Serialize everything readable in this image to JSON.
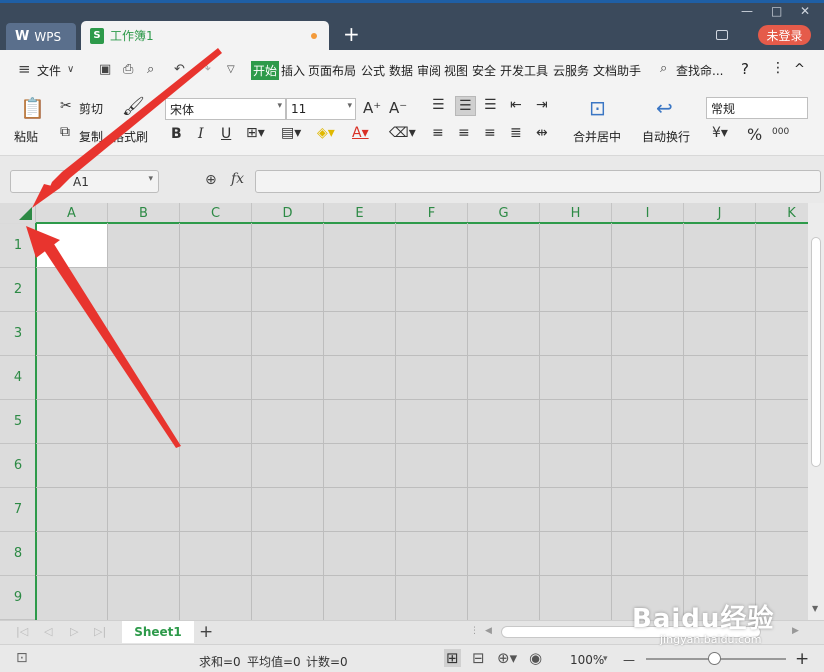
{
  "titlebar": {
    "wps_tab": "WPS",
    "doc_tab": "工作簿1",
    "new_tab": "+",
    "login": "未登录",
    "min": "—",
    "max": "□",
    "close": "✕"
  },
  "menubar": {
    "file": "文件",
    "tabs": [
      "开始",
      "插入",
      "页面布局",
      "公式",
      "数据",
      "审阅",
      "视图",
      "安全",
      "开发工具",
      "云服务",
      "文档助手"
    ],
    "search": "查找命...",
    "help": "?",
    "more": "⋮",
    "collapse": "^"
  },
  "ribbon": {
    "paste": "粘贴",
    "cut": "剪切",
    "copy": "复制",
    "format_painter": "格式刷",
    "font_name": "宋体",
    "font_size": "11",
    "bold": "B",
    "italic": "I",
    "underline": "U",
    "merge_center": "合并居中",
    "auto_wrap": "自动换行",
    "number_format": "常规",
    "percent": "%",
    "thousands": "000"
  },
  "formula_bar": {
    "name_box": "A1",
    "fx": "fx",
    "formula": ""
  },
  "grid": {
    "columns": [
      "A",
      "B",
      "C",
      "D",
      "E",
      "F",
      "G",
      "H",
      "I",
      "J",
      "K"
    ],
    "rows": [
      "1",
      "2",
      "3",
      "4",
      "5",
      "6",
      "7",
      "8",
      "9"
    ]
  },
  "sheets": {
    "active": "Sheet1",
    "add": "+"
  },
  "status": {
    "sum": "求和=0",
    "avg": "平均值=0",
    "count": "计数=0",
    "zoom": "100%",
    "zoom_out": "—",
    "zoom_in": "+"
  },
  "watermark": {
    "brand": "Baidu经验",
    "url": "jingyan.baidu.com"
  },
  "colors": {
    "accent_green": "#2d9a4a",
    "arrow_red": "#e8342e",
    "titlebar": "#3b4a5c"
  }
}
